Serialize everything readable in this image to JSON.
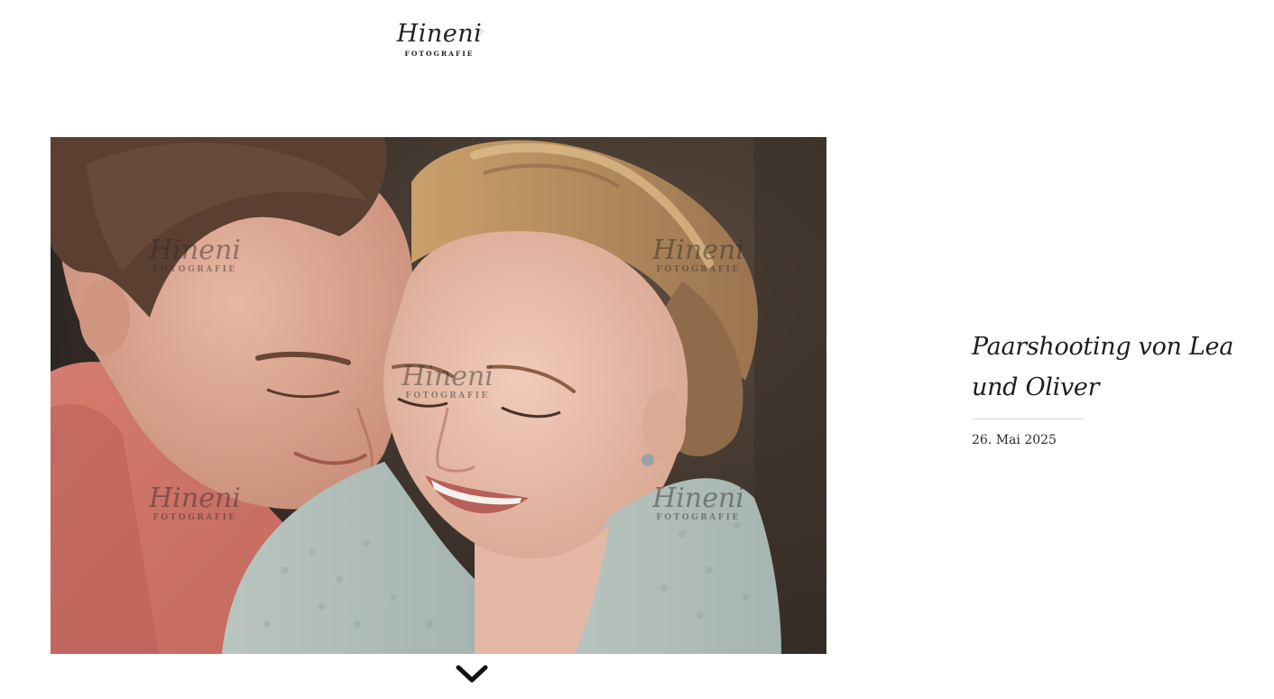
{
  "header": {
    "logo_script": "Hineni",
    "logo_subtitle": "FOTOGRAFIE"
  },
  "hero": {
    "watermark_script": "Hineni",
    "watermark_subtitle": "FOTOGRAFIE"
  },
  "post": {
    "title": "Paarshooting von Lea und Oliver",
    "date": "26. Mai 2025"
  },
  "scroll": {
    "icon": "chevron-down-icon"
  },
  "colors": {
    "text": "#1e1e1e",
    "rule": "#d6d6d6",
    "background": "#ffffff"
  }
}
